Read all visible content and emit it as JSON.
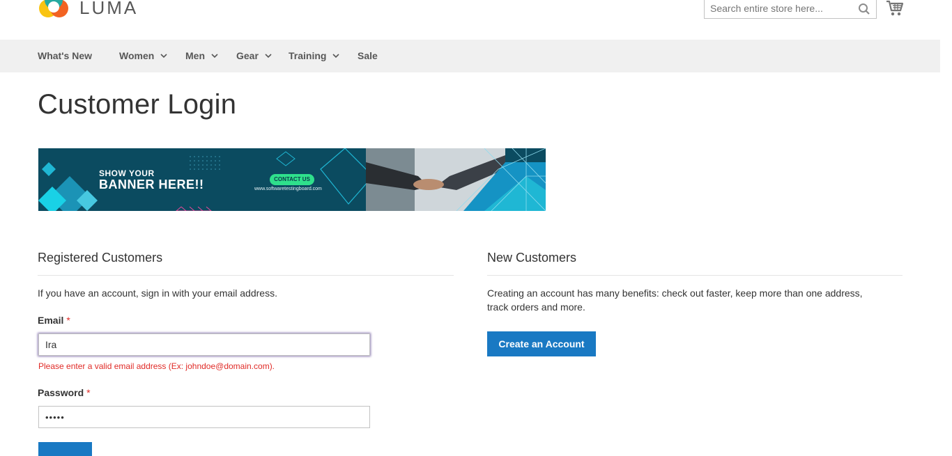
{
  "header": {
    "logo_text": "LUMA",
    "search_placeholder": "Search entire store here...",
    "search_icon": "search-icon",
    "cart_icon": "shopping-cart-icon"
  },
  "nav": {
    "items": [
      {
        "label": "What's New",
        "has_dropdown": false
      },
      {
        "label": "Women",
        "has_dropdown": true
      },
      {
        "label": "Men",
        "has_dropdown": true
      },
      {
        "label": "Gear",
        "has_dropdown": true
      },
      {
        "label": "Training",
        "has_dropdown": true
      },
      {
        "label": "Sale",
        "has_dropdown": false
      }
    ]
  },
  "page_title": "Customer Login",
  "banner": {
    "line1": "SHOW YOUR",
    "line2": "BANNER HERE!!",
    "cta": "CONTACT US",
    "url": "www.softwaretestingboard.com"
  },
  "registered": {
    "title": "Registered Customers",
    "intro": "If you have an account, sign in with your email address.",
    "email_label": "Email",
    "email_value": "Ira",
    "email_error": "Please enter a valid email address (Ex: johndoe@domain.com).",
    "password_label": "Password",
    "password_value": "•••••",
    "required_mark": "*"
  },
  "new_customers": {
    "title": "New Customers",
    "line1": "Creating an account has many benefits: check out faster, keep more than one address,",
    "line2": "track orders and more.",
    "create_button": "Create an Account"
  },
  "colors": {
    "primary": "#1979c3",
    "nav_bg": "#f0f0f0",
    "error": "#e02b27",
    "banner_bg": "#0a4a5f",
    "banner_cta": "#2fe08c"
  }
}
